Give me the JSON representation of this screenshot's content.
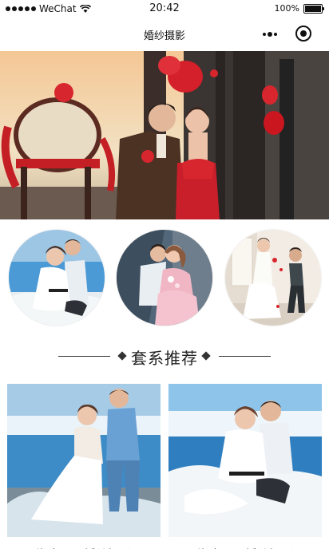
{
  "status_bar": {
    "carrier": "WeChat",
    "time": "20:42",
    "battery": "100%"
  },
  "nav": {
    "title": "婚纱摄影"
  },
  "section": {
    "title": "套系推荐"
  },
  "packages": [
    {
      "caption": "海南三亚婚纱摄影"
    },
    {
      "caption": "海南三亚婚纱摄影"
    }
  ],
  "colors": {
    "accent_red": "#d8262e",
    "text": "#222222",
    "sea_blue": "#4b9ad6"
  },
  "icons": [
    "signal-dots-icon",
    "wifi-icon",
    "battery-icon",
    "more-menu-icon",
    "close-capsule-icon"
  ]
}
